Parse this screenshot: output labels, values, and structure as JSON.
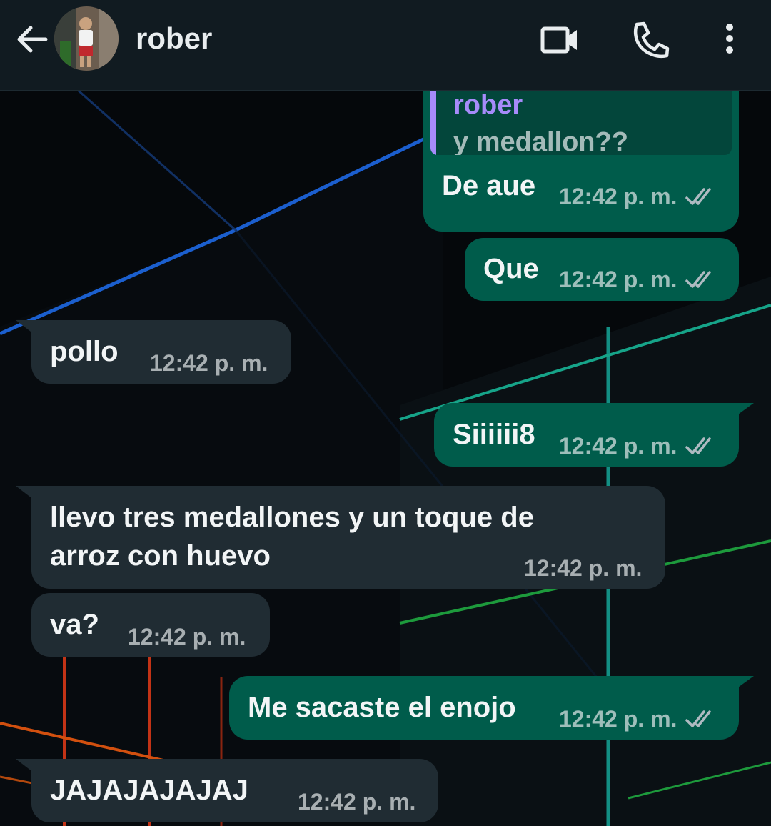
{
  "header": {
    "contact_name": "rober",
    "icons": {
      "back": "arrow-left-icon",
      "video": "video-camera-icon",
      "call": "phone-icon",
      "menu": "more-vertical-icon"
    }
  },
  "colors": {
    "header_bg": "#111b21",
    "outgoing_bubble": "#005c4b",
    "incoming_bubble": "#202c33",
    "quote_author": "#a78bfa",
    "read_ticks": "#aebac1"
  },
  "messages": [
    {
      "direction": "outgoing",
      "quoted": {
        "author": "rober",
        "text": "y medallon??"
      },
      "text": "De aue",
      "time": "12:42 p. m.",
      "status": "double-check-icon"
    },
    {
      "direction": "outgoing",
      "text": "Que",
      "time": "12:42 p. m.",
      "status": "double-check-icon"
    },
    {
      "direction": "incoming",
      "text": "pollo",
      "time": "12:42 p. m."
    },
    {
      "direction": "outgoing",
      "text": "Siiiiii8",
      "time": "12:42 p. m.",
      "status": "double-check-icon"
    },
    {
      "direction": "incoming",
      "lines": [
        "llevo tres medallones y un toque de",
        "arroz con huevo"
      ],
      "time": "12:42 p. m."
    },
    {
      "direction": "incoming",
      "text": "va?",
      "time": "12:42 p. m."
    },
    {
      "direction": "outgoing",
      "text": "Me sacaste el enojo",
      "time": "12:42 p. m.",
      "status": "double-check-icon"
    },
    {
      "direction": "incoming",
      "text": "JAJAJAJAJAJ",
      "time": "12:42 p. m."
    }
  ]
}
